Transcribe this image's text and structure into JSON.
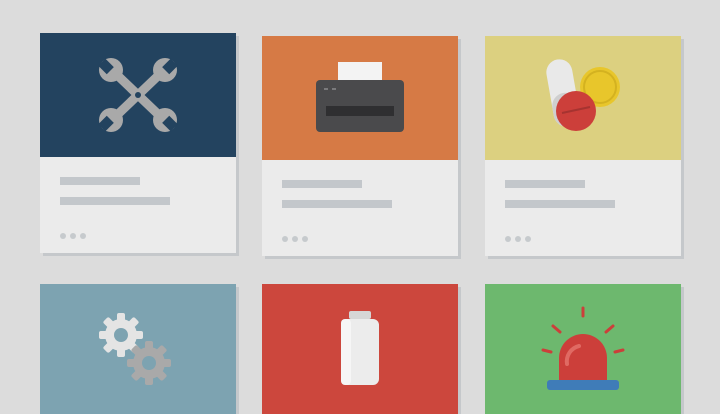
{
  "colors": {
    "background": "#dcdcdc",
    "card_body": "#ebebeb",
    "placeholder_bar": "#c3c7cb"
  },
  "cards": [
    {
      "name": "tools",
      "header_color": "#23435f",
      "icon": "wrench-screwdriver-icon"
    },
    {
      "name": "printer",
      "header_color": "#d67a45",
      "icon": "printer-icon"
    },
    {
      "name": "medicine",
      "header_color": "#dcd080",
      "icon": "pills-icon"
    },
    {
      "name": "settings",
      "header_color": "#7da3b1",
      "icon": "gears-icon"
    },
    {
      "name": "battery",
      "header_color": "#cc473d",
      "icon": "battery-icon"
    },
    {
      "name": "alarm",
      "header_color": "#6db86e",
      "icon": "siren-icon"
    }
  ]
}
